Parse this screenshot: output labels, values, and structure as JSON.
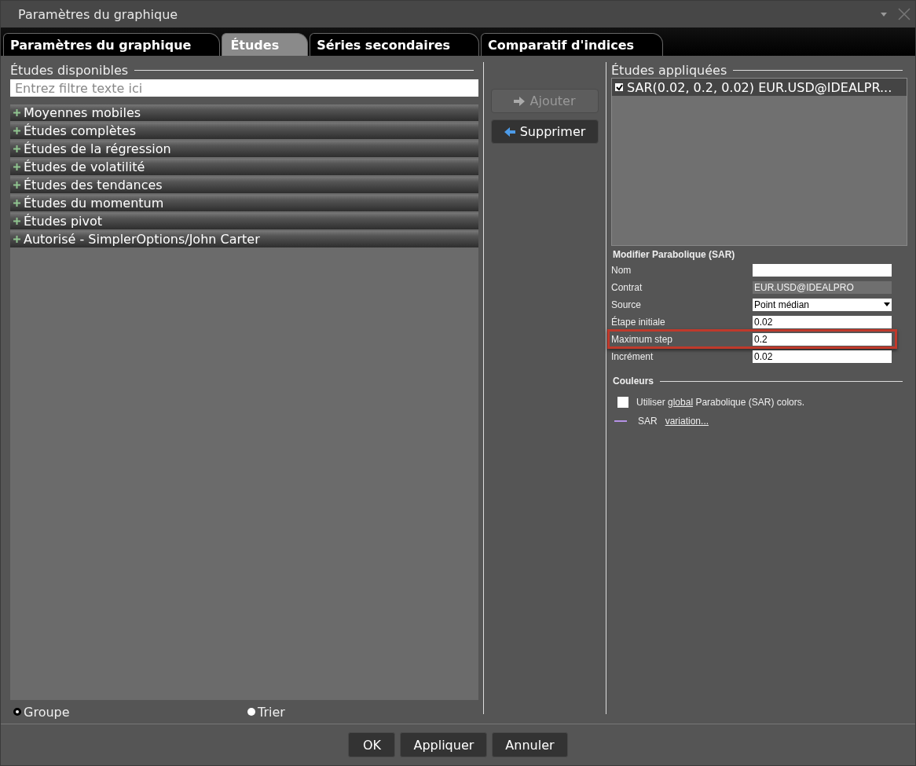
{
  "window": {
    "title": "Paramètres du graphique"
  },
  "tabs": [
    {
      "label": "Paramètres du graphique",
      "selected": false
    },
    {
      "label": "Études",
      "selected": true
    },
    {
      "label": "Séries secondaires",
      "selected": false
    },
    {
      "label": "Comparatif d'indices",
      "selected": false
    }
  ],
  "available": {
    "title": "Études disponibles",
    "filter": {
      "placeholder": "Entrez filtre texte ici"
    },
    "groups": [
      {
        "label": "Moyennes mobiles",
        "expanded": false
      },
      {
        "label": "Études complètes",
        "expanded": false
      },
      {
        "label": "Études de la régression",
        "expanded": false
      },
      {
        "label": "Études de volatilité",
        "expanded": false
      },
      {
        "label": "Études des tendances",
        "expanded": false
      },
      {
        "label": "Études du momentum",
        "expanded": false
      },
      {
        "label": "Études pivot",
        "expanded": false
      },
      {
        "label": "Autorisé - SimplerOptions/John Carter",
        "expanded": false
      }
    ],
    "view_options": [
      {
        "label": "Groupe",
        "selected": true
      },
      {
        "label": "Trier",
        "selected": false
      }
    ]
  },
  "actions": [
    {
      "kind": "add",
      "label": "Ajouter",
      "disabled": true
    },
    {
      "kind": "remove",
      "label": "Supprimer",
      "disabled": false
    }
  ],
  "applied": {
    "title": "Études appliquées",
    "items": [
      {
        "label": "SAR(0.02, 0.2, 0.02) EUR.USD@IDEALPR...",
        "checked": true,
        "selected": true
      }
    ]
  },
  "editor": {
    "title": "Modifier Parabolique (SAR)",
    "fields": [
      {
        "label": "Nom",
        "kind": "text",
        "highlighted": false
      },
      {
        "label": "Contrat",
        "kind": "readonly",
        "value": "EUR.USD@IDEALPRO",
        "highlighted": false
      },
      {
        "label": "Source",
        "kind": "select",
        "value": "Point médian",
        "highlighted": false
      },
      {
        "label": "Étape initiale",
        "kind": "text",
        "value": "0.02",
        "highlighted": false
      },
      {
        "label": "Maximum step",
        "kind": "text",
        "value": "0.2",
        "highlighted": true
      },
      {
        "label": "Incrément",
        "kind": "text",
        "value": "0.02",
        "highlighted": false
      }
    ],
    "colors": {
      "title": "Couleurs",
      "use_global": {
        "checked": false,
        "before": "Utiliser",
        "link": "global",
        "after": "Parabolique (SAR) colors."
      },
      "series": [
        {
          "name": "SAR",
          "color": "#b592e6",
          "link": "variation..."
        }
      ]
    }
  },
  "buttons": [
    "OK",
    "Appliquer",
    "Annuler"
  ]
}
